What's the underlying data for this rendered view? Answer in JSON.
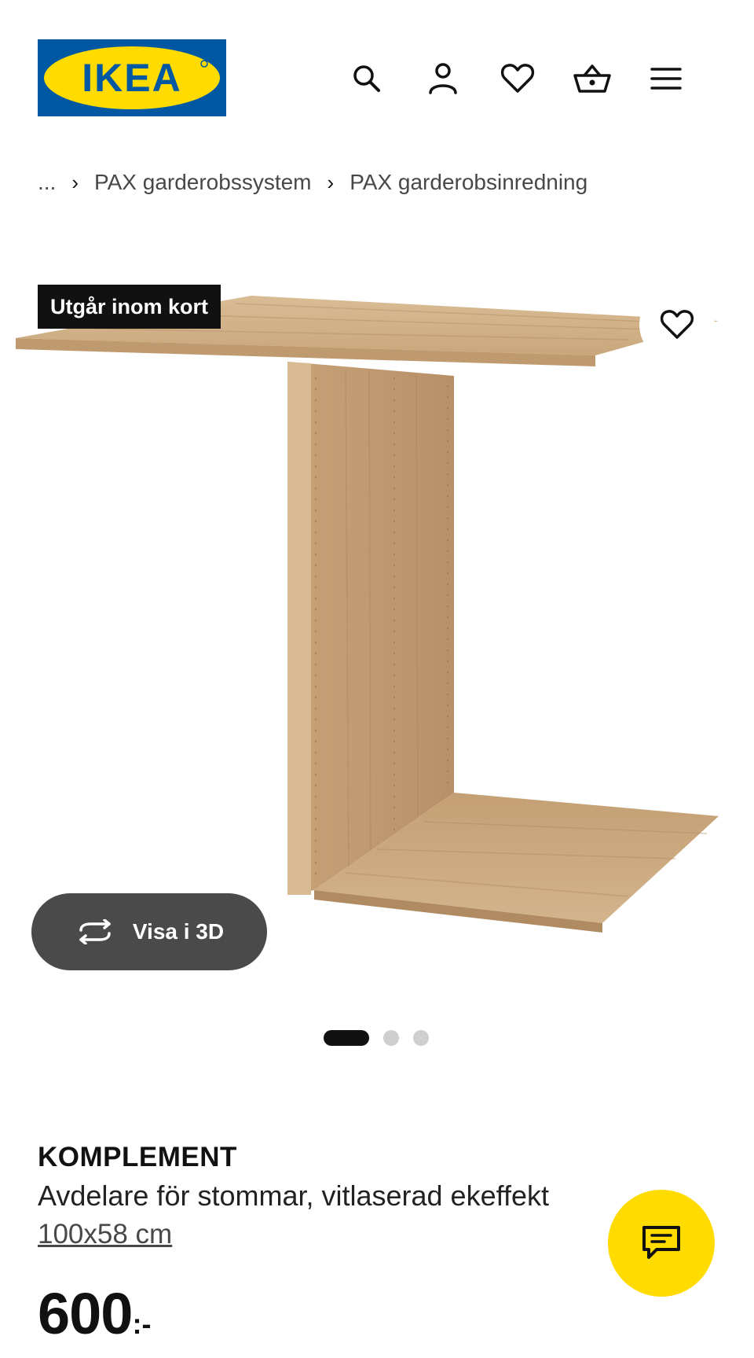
{
  "header": {
    "logo_text": "IKEA",
    "brand_colors": {
      "blue": "#0058a3",
      "yellow": "#ffdb00"
    },
    "icons": [
      "search-icon",
      "profile-icon",
      "heart-icon",
      "basket-icon",
      "menu-icon"
    ]
  },
  "breadcrumb": {
    "ellipsis": "...",
    "items": [
      {
        "label": "PAX garderobssystem"
      },
      {
        "label": "PAX garderobsinredning"
      }
    ],
    "separator": "›"
  },
  "gallery": {
    "badge": "Utgår inom kort",
    "view_3d_label": "Visa i 3D",
    "slides_total": 3,
    "active_slide": 1
  },
  "product": {
    "name": "KOMPLEMENT",
    "description": "Avdelare för stommar, vitlaserad ekeffekt",
    "size": "100x58 cm",
    "price": "600",
    "price_suffix": ":-"
  },
  "chat": {
    "icon": "chat-icon",
    "color": "#ffdb00"
  }
}
